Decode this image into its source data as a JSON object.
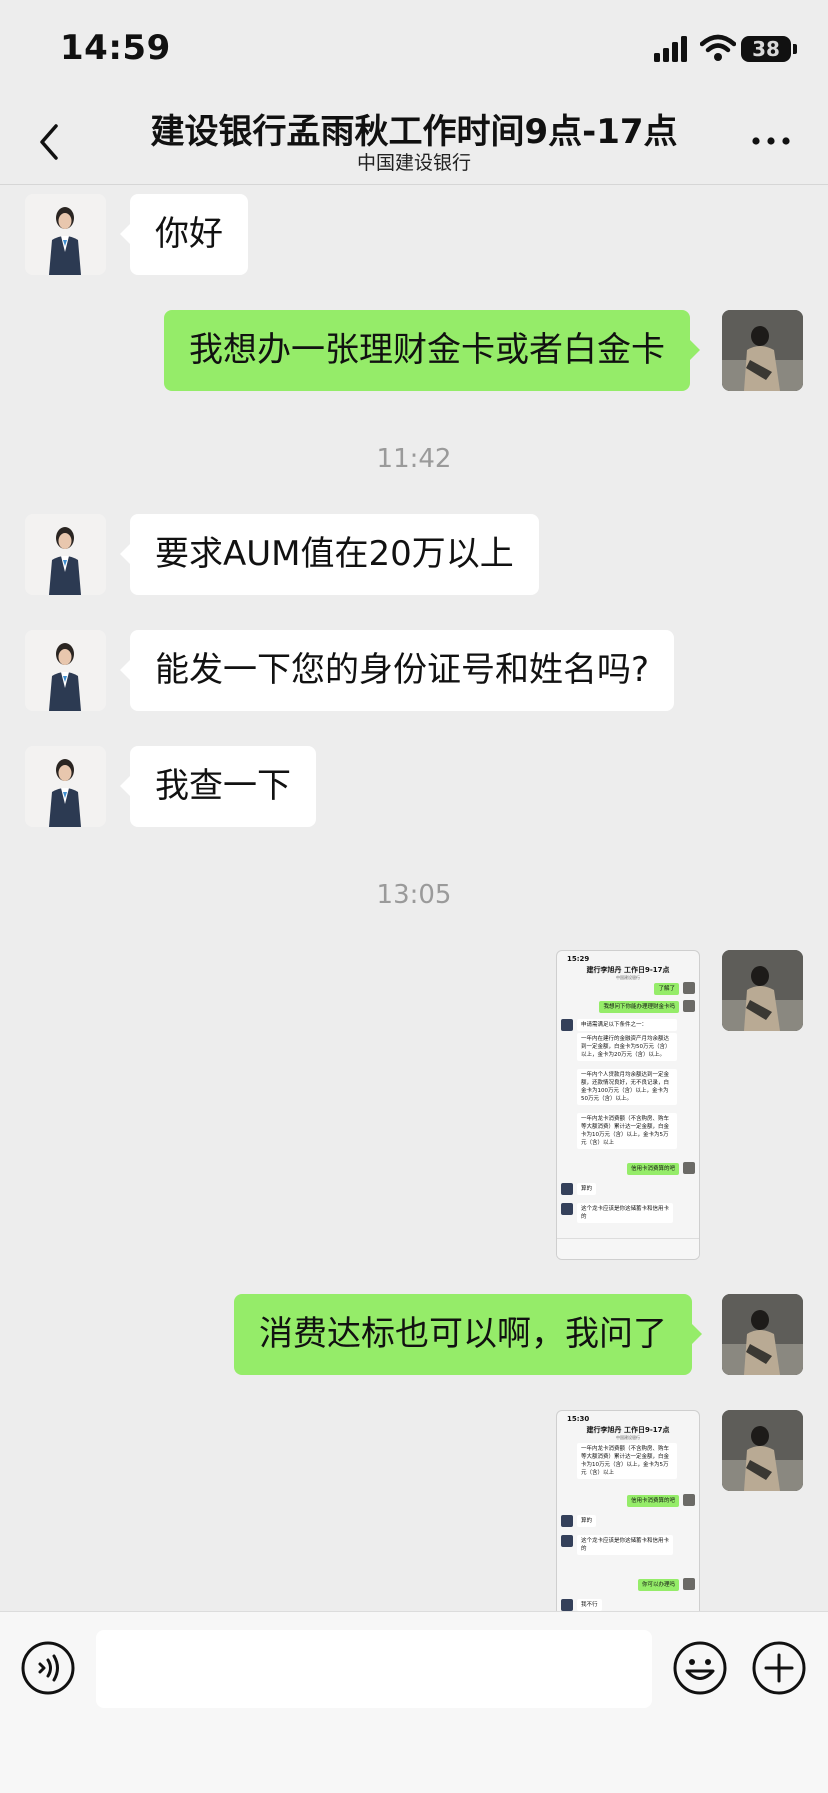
{
  "status_bar": {
    "time": "14:59",
    "battery": "38"
  },
  "header": {
    "title": "建设银行孟雨秋工作时间9点-17点",
    "subtitle": "中国建设银行"
  },
  "messages": [
    {
      "side": "left",
      "text": "你好"
    },
    {
      "side": "right",
      "text": "我想办一张理财金卡或者白金卡"
    },
    {
      "timestamp": "11:42"
    },
    {
      "side": "left",
      "text": "要求AUM值在20万以上"
    },
    {
      "side": "left",
      "text": "能发一下您的身份证号和姓名吗?"
    },
    {
      "side": "left",
      "text": "我查一下"
    },
    {
      "timestamp": "13:05"
    },
    {
      "side": "right",
      "type": "image",
      "description": "screenshot"
    },
    {
      "side": "right",
      "text": "消费达标也可以啊，我问了"
    },
    {
      "side": "right",
      "type": "image",
      "description": "screenshot"
    }
  ],
  "shot1": {
    "time": "15:29",
    "title": "建行李旭丹 工作日9-17点",
    "subtitle": "中国建设银行",
    "m1": "了解了",
    "m2": "我想问下你能办理理财金卡吗",
    "m3": "申请需满足以下条件之一：",
    "m4": "一年内在建行的金融资产月均余额达到一定金额，白金卡为50万元（含）以上，金卡为20万元（含）以上。",
    "m5": "一年内个人贷款月均余额达到一定金额，还款情况良好，无不良记录，白金卡为100万元（含）以上，金卡为50万元（含）以上。",
    "m6": "一年内龙卡消费额（不含购房、购车等大额消费）累计达一定金额，白金卡为10万元（含）以上，金卡为5万元（含）以上",
    "m7": "信用卡消费算的吧",
    "m8": "算的",
    "m9": "这个龙卡应该是你这储蓄卡和信用卡的"
  },
  "shot2": {
    "time": "15:30",
    "title": "建行李旭丹 工作日9-17点",
    "subtitle": "中国建设银行",
    "m1": "一年内龙卡消费额（不含购房、购车等大额消费）累计达一定金额，白金卡为10万元（含）以上，金卡为5万元（含）以上",
    "m2": "信用卡消费算的吧",
    "m3": "算的",
    "m4": "这个龙卡应该是你这储蓄卡和信用卡的",
    "m5": "你可以办理吗",
    "m6": "我不行"
  },
  "input": {
    "placeholder": ""
  },
  "icons": {
    "back": "chevron-left-icon",
    "more": "more-dots-icon",
    "voice": "voice-icon",
    "emoji": "emoji-icon",
    "plus": "plus-icon"
  },
  "colors": {
    "background": "#ededed",
    "bubble_self": "#95ec69",
    "bubble_other": "#ffffff",
    "timestamp": "#9a9a9a"
  }
}
